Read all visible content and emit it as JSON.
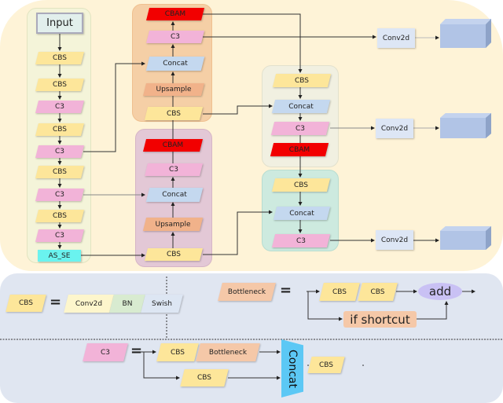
{
  "backbone": {
    "input": "Input",
    "blocks": [
      "CBS",
      "CBS",
      "C3",
      "CBS",
      "C3",
      "CBS",
      "C3",
      "CBS",
      "C3",
      "AS_SE"
    ]
  },
  "neck_top": {
    "blocks": [
      "CBAM",
      "C3",
      "Concat",
      "Upsample",
      "CBS"
    ]
  },
  "neck_mid": {
    "blocks": [
      "CBAM",
      "C3",
      "Concat",
      "Upsample",
      "CBS"
    ]
  },
  "pan_top": {
    "blocks": [
      "CBS",
      "Concat",
      "C3",
      "CBAM"
    ]
  },
  "pan_bot": {
    "blocks": [
      "CBS",
      "Concat",
      "C3"
    ]
  },
  "heads": [
    "Conv2d",
    "Conv2d",
    "Conv2d"
  ],
  "legend": {
    "cbs": {
      "name": "CBS",
      "eq": "=",
      "parts": [
        "Conv2d",
        "BN",
        "Swish"
      ]
    },
    "bottleneck": {
      "name": "Bottleneck",
      "eq": "=",
      "parts": [
        "CBS",
        "CBS"
      ],
      "add": "add",
      "shortcut": "if shortcut"
    },
    "c3": {
      "name": "C3",
      "eq": "=",
      "top": [
        "CBS",
        "Bottleneck"
      ],
      "bottom": "CBS",
      "concat": "Concat",
      "out": "CBS"
    }
  },
  "colors": {
    "cbs": "#fde69a",
    "c3": "#f2b3d8",
    "concat": "#c4d8ef",
    "upsample": "#f1b28a",
    "cbam": "#f20000",
    "as_se": "#6af3ef",
    "conv2d": "#dde6f5",
    "cube": "#b1c4e6"
  }
}
